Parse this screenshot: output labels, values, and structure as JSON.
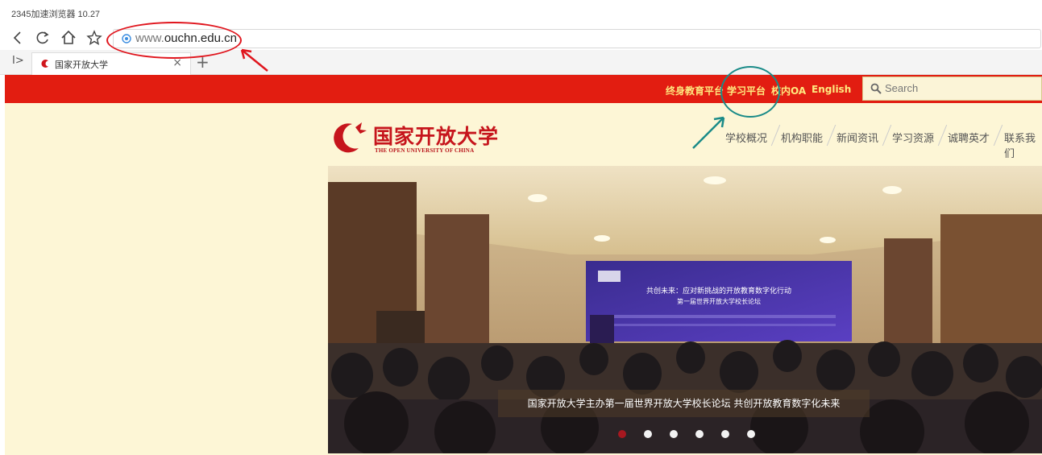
{
  "browser": {
    "title": "2345加速浏览器 10.27",
    "url": "www.ouchn.edu.cn",
    "url_prefix": "www.",
    "url_domain": "ouchn.edu.cn",
    "tab": {
      "label": "国家开放大学",
      "close": "×"
    },
    "new_tab": "+",
    "tab_toggle": "I>"
  },
  "site": {
    "topnav": [
      "终身教育平台",
      "学习平台",
      "校内OA",
      "English"
    ],
    "search_placeholder": "Search",
    "logo_cn": "国家开放大学",
    "logo_en": "THE OPEN UNIVERSITY OF CHINA",
    "mainnav": [
      "学校概况",
      "机构职能",
      "新闻资讯",
      "学习资源",
      "诚聘英才",
      "联系我们"
    ],
    "hero": {
      "caption": "国家开放大学主办第一届世界开放大学校长论坛 共创开放教育数字化未来",
      "slides_count": 6,
      "active_slide": 1,
      "stage_title": "共创未来：应对新挑战的开放教育数字化行动",
      "stage_subtitle": "第一届世界开放大学校长论坛"
    }
  },
  "colors": {
    "brand_red": "#e21d11",
    "nav_yellow": "#ffea80",
    "header_bg": "#fdf6d6",
    "annotation_red": "#e0151d",
    "annotation_teal": "#1a8b88"
  }
}
